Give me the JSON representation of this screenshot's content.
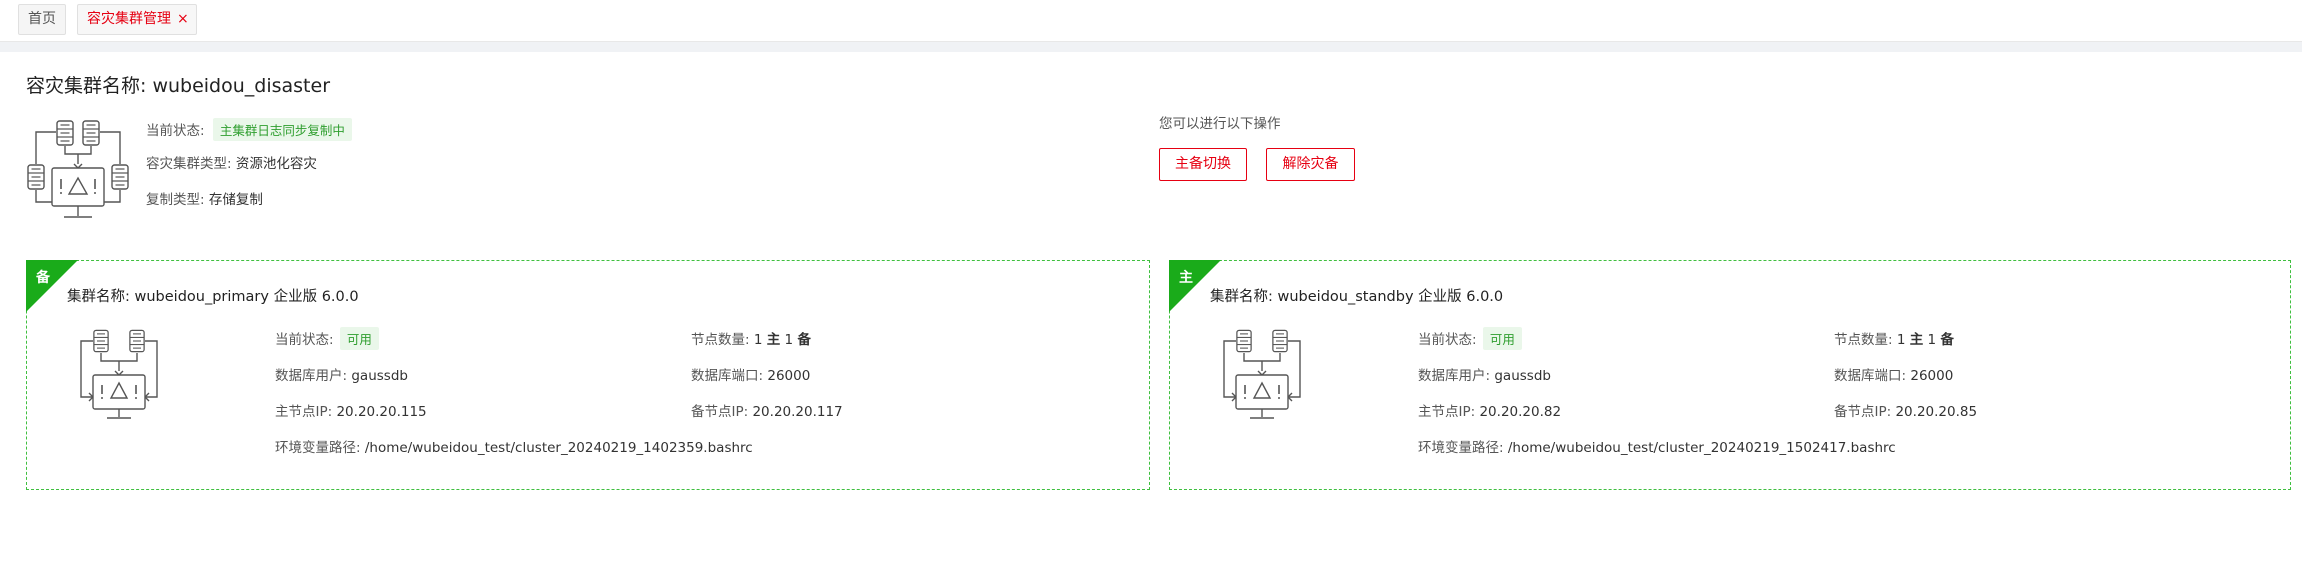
{
  "tabs": [
    {
      "label": "首页"
    },
    {
      "label": "容灾集群管理",
      "close": "×"
    }
  ],
  "header": {
    "title": "容灾集群名称: wubeidou_disaster",
    "status_label": "当前状态:",
    "status_value": "主集群日志同步复制中",
    "type_label": "容灾集群类型:",
    "type_value": "资源池化容灾",
    "repl_label": "复制类型:",
    "repl_value": "存储复制"
  },
  "operations": {
    "hint": "您可以进行以下操作",
    "switch_label": "主备切换",
    "remove_label": "解除灾备"
  },
  "clusters": [
    {
      "role": "备",
      "name_label": "集群名称:",
      "name": "wubeidou_primary",
      "edition": "企业版",
      "version": "6.0.0",
      "status_label": "当前状态:",
      "status": "可用",
      "nodes_label": "节点数量:",
      "nodes_primary": "1",
      "nodes_primary_unit": "主",
      "nodes_standby": "1",
      "nodes_standby_unit": "备",
      "db_user_label": "数据库用户:",
      "db_user": "gaussdb",
      "db_port_label": "数据库端口:",
      "db_port": "26000",
      "primary_ip_label": "主节点IP:",
      "primary_ip": "20.20.20.115",
      "standby_ip_label": "备节点IP:",
      "standby_ip": "20.20.20.117",
      "env_label": "环境变量路径:",
      "env_path": "/home/wubeidou_test/cluster_20240219_1402359.bashrc"
    },
    {
      "role": "主",
      "name_label": "集群名称:",
      "name": "wubeidou_standby",
      "edition": "企业版",
      "version": "6.0.0",
      "status_label": "当前状态:",
      "status": "可用",
      "nodes_label": "节点数量:",
      "nodes_primary": "1",
      "nodes_primary_unit": "主",
      "nodes_standby": "1",
      "nodes_standby_unit": "备",
      "db_user_label": "数据库用户:",
      "db_user": "gaussdb",
      "db_port_label": "数据库端口:",
      "db_port": "26000",
      "primary_ip_label": "主节点IP:",
      "primary_ip": "20.20.20.82",
      "standby_ip_label": "备节点IP:",
      "standby_ip": "20.20.20.85",
      "env_label": "环境变量路径:",
      "env_path": "/home/wubeidou_test/cluster_20240219_1502417.bashrc"
    }
  ],
  "colors": {
    "accent": "#e60012",
    "success": "#2e9e2e",
    "card_border": "#3fbf3f",
    "corner": "#1aab1a"
  },
  "icons": {
    "topology": "cluster-topology-icon",
    "close": "close-icon"
  }
}
